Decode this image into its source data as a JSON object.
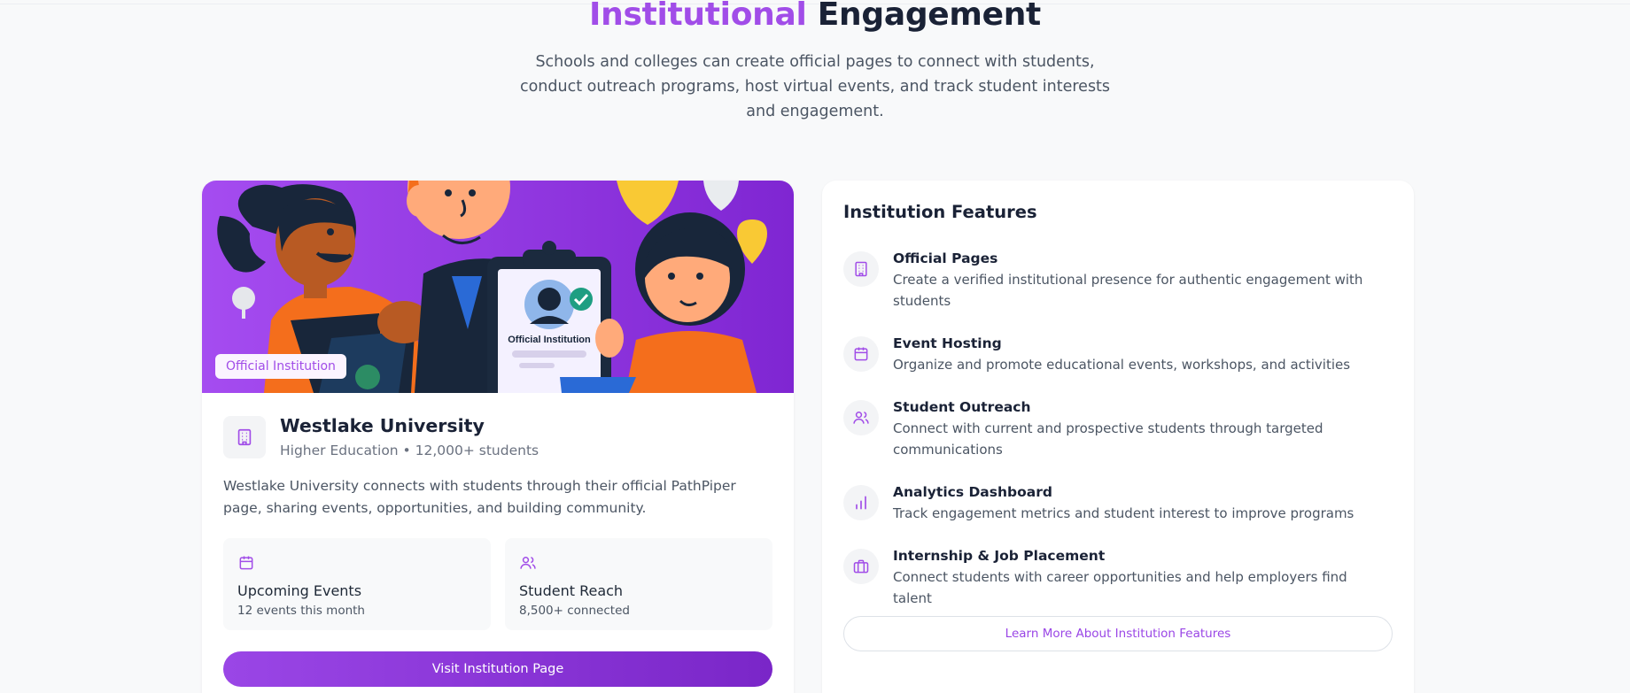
{
  "hero": {
    "title_accent": "Institutional",
    "title_rest": " Engagement",
    "subtitle": "Schools and colleges can create official pages to connect with students, conduct outreach programs, host virtual events, and track student interests and engagement."
  },
  "institution_card": {
    "banner_badge": "Official Institution",
    "illustration_text": "Official Institution",
    "name": "Westlake University",
    "meta": "Higher Education • 12,000+ students",
    "description": "Westlake University connects with students through their official PathPiper page, sharing events, opportunities, and building community.",
    "stats": [
      {
        "icon": "calendar-icon",
        "label": "Upcoming Events",
        "value": "12 events this month"
      },
      {
        "icon": "users-icon",
        "label": "Student Reach",
        "value": "8,500+ connected"
      }
    ],
    "button_label": "Visit Institution Page"
  },
  "features_card": {
    "title": "Institution Features",
    "items": [
      {
        "icon": "building-icon",
        "title": "Official Pages",
        "description": "Create a verified institutional presence for authentic engagement with students"
      },
      {
        "icon": "calendar-icon",
        "title": "Event Hosting",
        "description": "Organize and promote educational events, workshops, and activities"
      },
      {
        "icon": "users-icon",
        "title": "Student Outreach",
        "description": "Connect with current and prospective students through targeted communications"
      },
      {
        "icon": "bar-chart-icon",
        "title": "Analytics Dashboard",
        "description": "Track engagement metrics and student interest to improve programs"
      },
      {
        "icon": "briefcase-icon",
        "title": "Internship & Job Placement",
        "description": "Connect students with career opportunities and help employers find talent"
      }
    ],
    "button_label": "Learn More About Institution Features"
  },
  "colors": {
    "accent": "#a14de8",
    "button_gradient_start": "#9a46e6",
    "button_gradient_end": "#7a26c8",
    "banner_purple": "#9b3ee8",
    "heading": "#1a2236",
    "body_text": "#4b5563"
  }
}
